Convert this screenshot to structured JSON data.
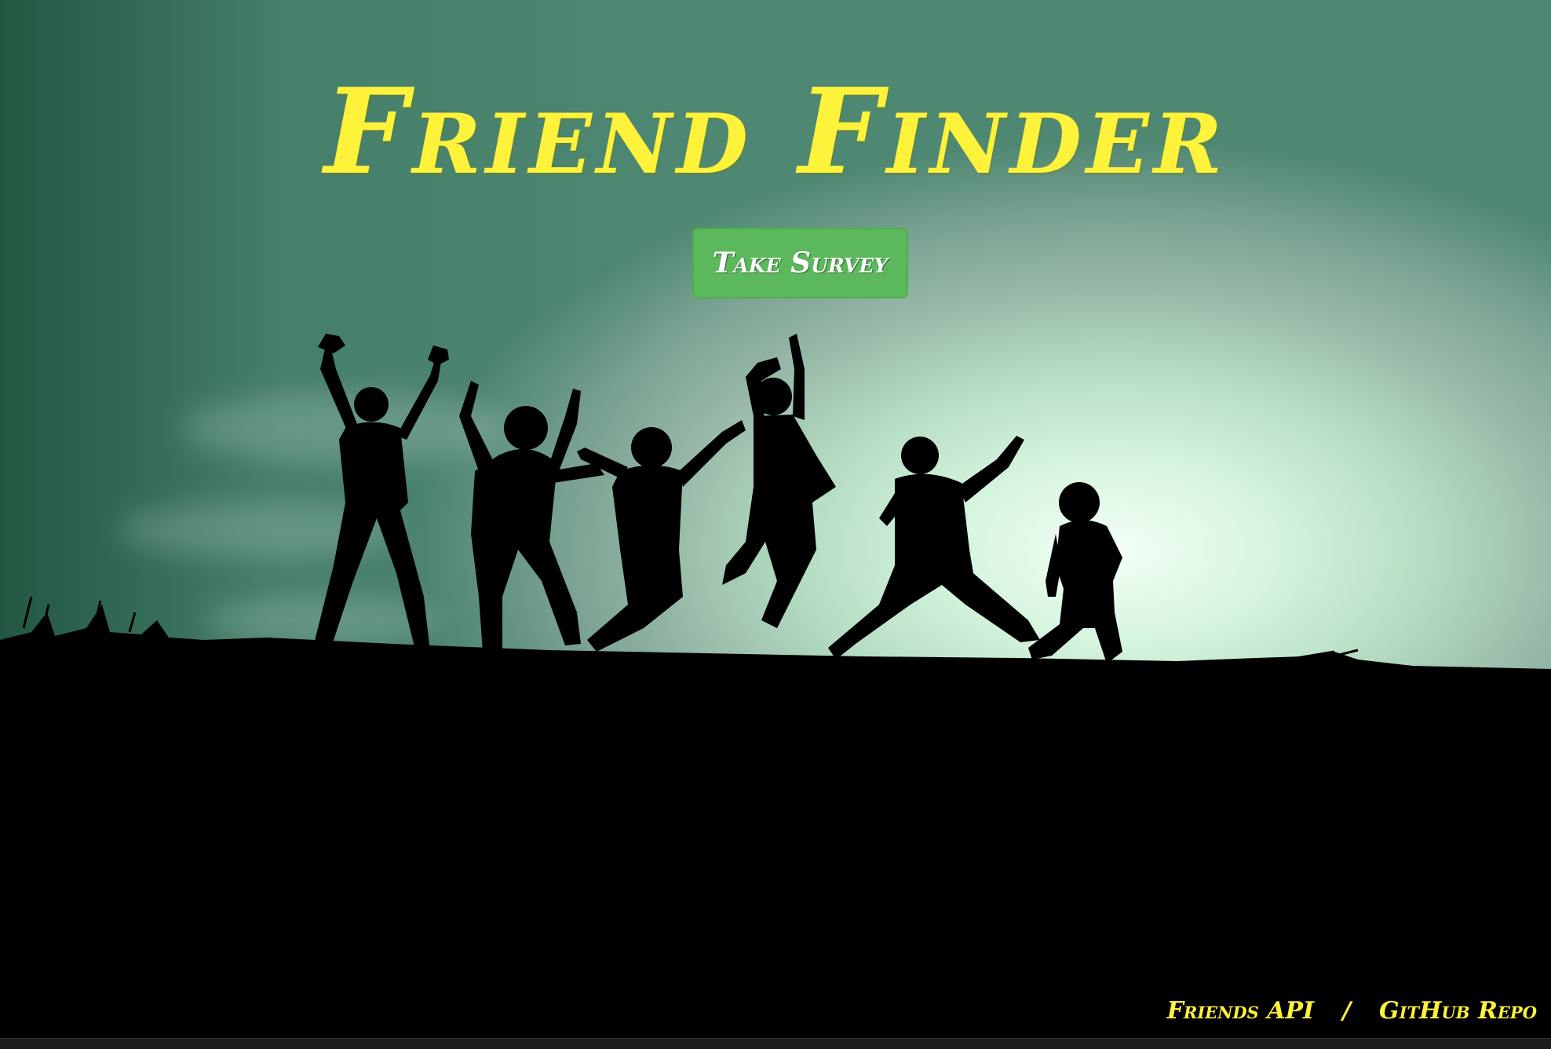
{
  "app": {
    "title": "Friend Finder"
  },
  "hero": {
    "survey_button_label": "Take Survey"
  },
  "footer": {
    "links": [
      {
        "label": "Friends API"
      },
      {
        "label": "GitHub Repo"
      }
    ],
    "separator": "/"
  },
  "colors": {
    "title": "#fff23a",
    "button_bg": "#5cb85c",
    "button_text": "#ffffff",
    "ground": "#000000"
  },
  "image": {
    "description_icon": "jumping-friends-silhouette-image"
  }
}
